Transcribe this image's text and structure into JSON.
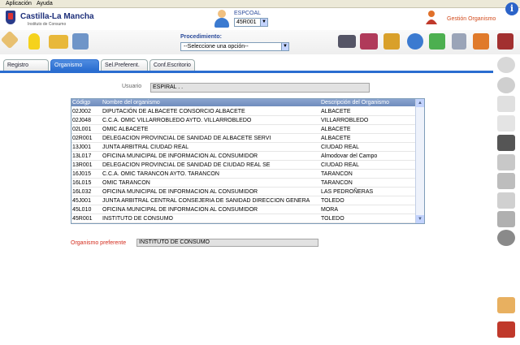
{
  "menu": {
    "items": [
      "Aplicación",
      "Ayuda"
    ]
  },
  "header": {
    "logo_title": "Castilla-La Mancha",
    "logo_subtitle": "Instituto de Consumo",
    "espco_label": "ESPCOAL",
    "espco_value": "45R001",
    "gestion_label": "Gestión Organismo"
  },
  "procedimiento": {
    "label": "Procedimiento:",
    "value": "--Seleccione una opción--"
  },
  "tabs": [
    {
      "label": "Registro"
    },
    {
      "label": "Organismo"
    },
    {
      "label": "Sel.Preferent."
    },
    {
      "label": "Conf.Escritorio"
    }
  ],
  "usuario": {
    "label": "Usuario",
    "value": "ESPIRAL . ."
  },
  "table": {
    "headers": [
      "Códigp",
      "Nombre del organismo",
      "Descripción del Organismo"
    ],
    "rows": [
      [
        "02J002",
        "DIPUTACIÓN DE ALBACETE CONSORCIO ALBACETE",
        "ALBACETE"
      ],
      [
        "02J048",
        "C.C.A. OMIC VILLARROBLEDO AYTO.  VILLARROBLEDO",
        "VILLARROBLEDO"
      ],
      [
        "02L001",
        "OMIC ALBACETE",
        "ALBACETE"
      ],
      [
        "02R001",
        "DELEGACION PROVINCIAL DE SANIDAD DE ALBACETE SERVI",
        "ALBACETE"
      ],
      [
        "13J001",
        "JUNTA ARBITRAL CIUDAD REAL",
        "CIUDAD REAL"
      ],
      [
        "13L017",
        "OFICINA MUNICIPAL DE INFORMACION AL CONSUMIDOR",
        "Almodovar del Campo"
      ],
      [
        "13R001",
        "DELEGACION PROVINCIAL DE SANIDAD DE CIUDAD REAL SE",
        "CIUDAD REAL"
      ],
      [
        "16J015",
        "C.C.A. OMIC TARANCON AYTO. TARANCON",
        "TARANCON"
      ],
      [
        "16L015",
        "OMIC TARANCON",
        "TARANCON"
      ],
      [
        "16L032",
        "OFICINA MUNICIPAL DE INFORMACION AL CONSUMIDOR",
        "LAS PEDROÑERAS"
      ],
      [
        "45J001",
        "JUNTA ARBITRAL CENTRAL CONSEJERIA DE SANIDAD DIRECCION GENERA",
        "TOLEDO"
      ],
      [
        "45L010",
        "OFICINA MUNICIPAL DE INFORMACION AL CONSUMIDOR",
        "MORA"
      ],
      [
        "45R001",
        "INSTITUTO DE CONSUMO",
        "TOLEDO"
      ]
    ]
  },
  "organismo_preferente": {
    "label": "Organismo preferente",
    "value": "INSTITUTO DE CONSUMO"
  },
  "icons": {
    "toolbar": [
      "tools-icon",
      "lightbulb-icon",
      "folder-icon",
      "network-icon",
      "laptop-icon",
      "books-icon",
      "archive-icon",
      "globe-icon",
      "search-chart-icon",
      "download-icon",
      "chart-icon",
      "exit-icon"
    ],
    "sidebar": [
      "zoom-in-icon",
      "back-icon",
      "document-icon",
      "pages-icon",
      "save-icon",
      "print-icon",
      "tag-icon",
      "pen-icon",
      "text-tool-icon",
      "settings-icon",
      "tools-icon",
      "car-icon"
    ]
  },
  "colors": {
    "accent": "#2a6dd0",
    "brand": "#1d2f7a",
    "alert": "#d32b1c"
  }
}
